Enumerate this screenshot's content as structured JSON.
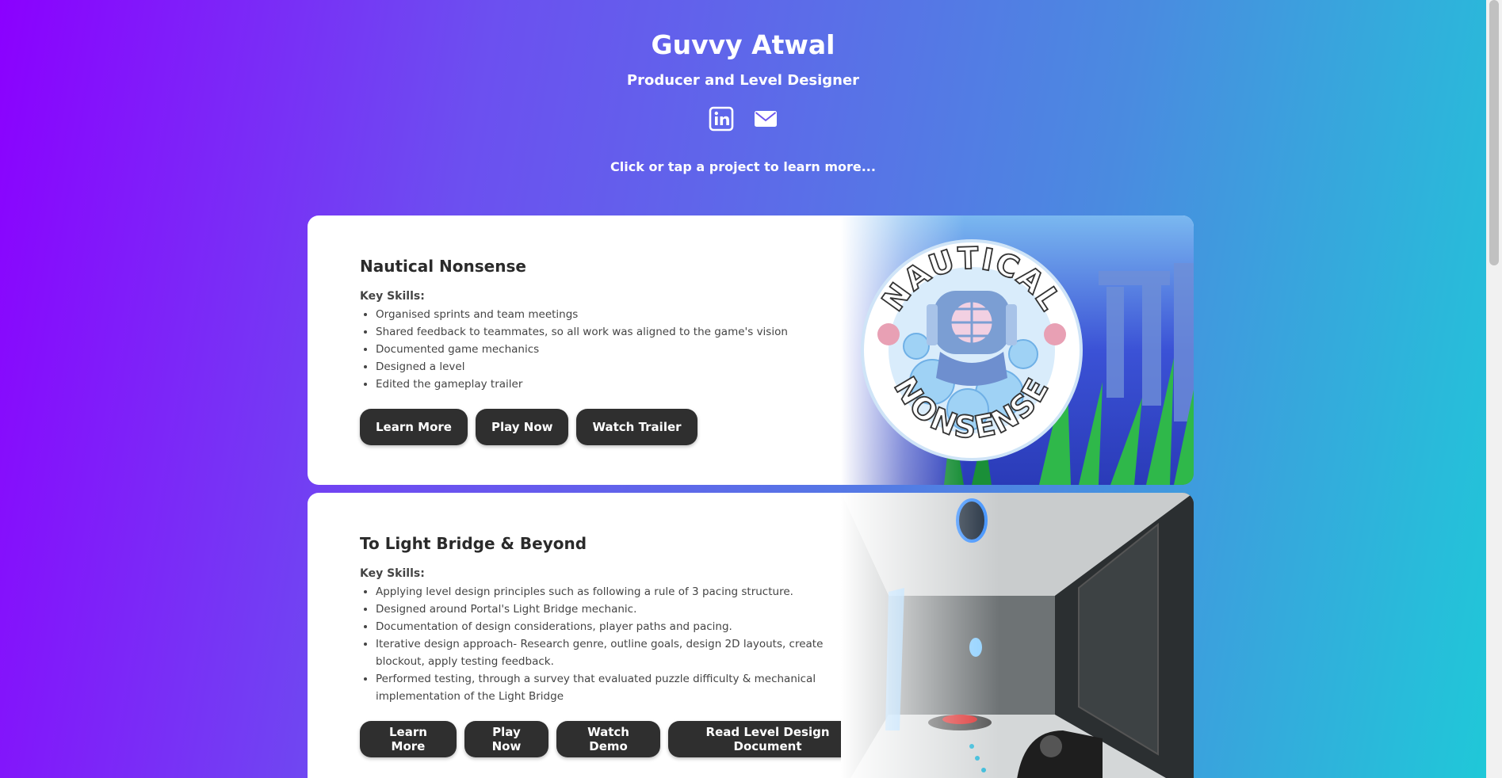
{
  "header": {
    "name": "Guvvy Atwal",
    "role": "Producer and Level Designer",
    "hint": "Click or tap a project to learn more..."
  },
  "socials": [
    {
      "icon": "linkedin-icon"
    },
    {
      "icon": "email-icon"
    }
  ],
  "projects": [
    {
      "title": "Nautical Nonsense",
      "skills_label": "Key Skills:",
      "skills": [
        "Organised sprints and team meetings",
        "Shared feedback to teammates, so all work was aligned to the game's vision",
        "Documented game mechanics",
        "Designed a level",
        "Edited the gameplay trailer"
      ],
      "buttons": [
        "Learn More",
        "Play Now",
        "Watch Trailer"
      ],
      "logo_text": "NAUTICAL NONSENSE"
    },
    {
      "title": "To Light Bridge & Beyond",
      "skills_label": "Key Skills:",
      "skills": [
        "Applying level design principles such as following a rule of 3 pacing structure.",
        "Designed around Portal's Light Bridge mechanic.",
        "Documentation of design considerations, player paths and pacing.",
        "Iterative design approach- Research genre, outline goals, design 2D layouts, create blockout, apply testing feedback.",
        "Performed testing, through a survey that evaluated puzzle difficulty & mechanical implementation of the Light Bridge"
      ],
      "buttons": [
        "Learn More",
        "Play Now",
        "Watch Demo",
        "Read Level Design Document"
      ]
    }
  ],
  "colors": {
    "gradient_start": "#8b00ff",
    "gradient_end": "#1ecad8",
    "button_bg": "#2f2f2f",
    "card_bg": "#ffffff"
  }
}
